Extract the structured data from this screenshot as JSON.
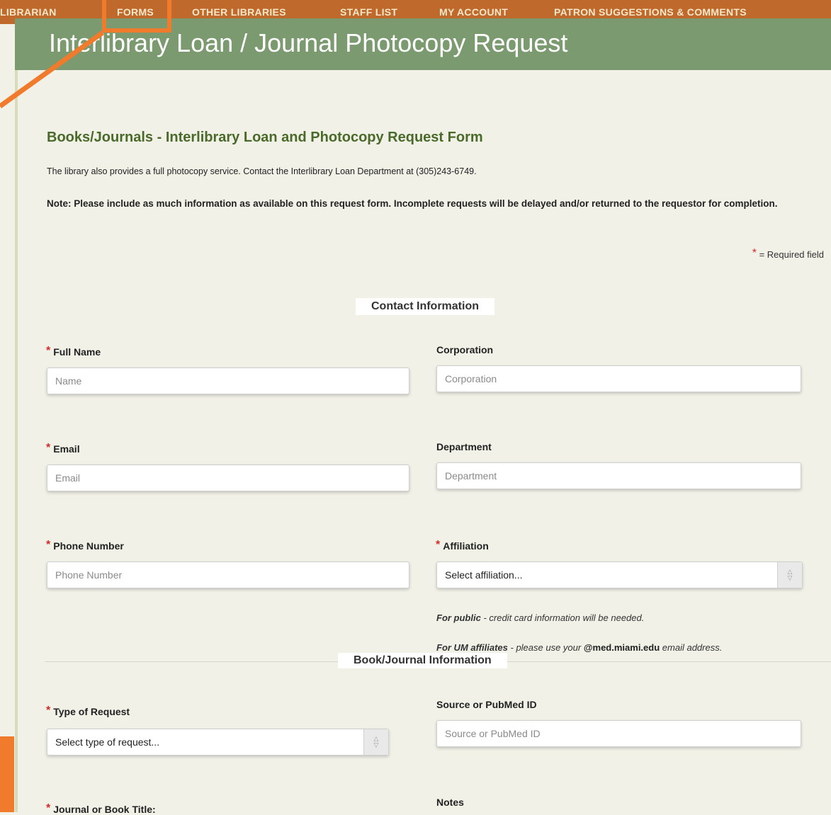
{
  "nav": {
    "items": [
      "LIBRARIAN",
      "FORMS",
      "OTHER LIBRARIES",
      "STAFF LIST",
      "MY ACCOUNT",
      "PATRON SUGGESTIONS & COMMENTS"
    ]
  },
  "header": {
    "title": "Interlibrary Loan / Journal Photocopy Request"
  },
  "form": {
    "heading": "Books/Journals - Interlibrary Loan and Photocopy Request Form",
    "intro": "The library also provides a full photocopy service. Contact the Interlibrary Loan Department at (305)243-6749.",
    "note": "Note: Please include as much information as available on this request form. Incomplete requests will be delayed and/or returned to the requestor for completion.",
    "required_legend": "= Required field",
    "asterisk": "*"
  },
  "contact": {
    "section_title": "Contact Information",
    "full_name": {
      "label": "Full Name",
      "placeholder": "Name"
    },
    "corporation": {
      "label": "Corporation",
      "placeholder": "Corporation"
    },
    "email": {
      "label": "Email",
      "placeholder": "Email"
    },
    "department": {
      "label": "Department",
      "placeholder": "Department"
    },
    "phone": {
      "label": "Phone Number",
      "placeholder": "Phone Number"
    },
    "affiliation": {
      "label": "Affiliation",
      "selected": "Select affiliation..."
    },
    "hint_public_lead": "For public",
    "hint_public_rest": " - credit card information will be needed.",
    "hint_um_lead": "For UM affiliates",
    "hint_um_mid": " - please use your ",
    "hint_um_email": "@med.miami.edu",
    "hint_um_rest": " email address."
  },
  "book": {
    "section_title": "Book/Journal Information",
    "type_of_request": {
      "label": "Type of Request",
      "selected": "Select type of request..."
    },
    "source": {
      "label": "Source or PubMed ID",
      "placeholder": "Source or PubMed ID"
    },
    "title": {
      "label": "Journal or Book Title:"
    },
    "notes": {
      "label": "Notes"
    }
  },
  "colors": {
    "nav_bg": "#bf6a2c",
    "header_bg": "#7b9a6f",
    "heading_green": "#4a6a2a",
    "required_red": "#d32a2a",
    "callout_orange": "#f07b2c"
  }
}
